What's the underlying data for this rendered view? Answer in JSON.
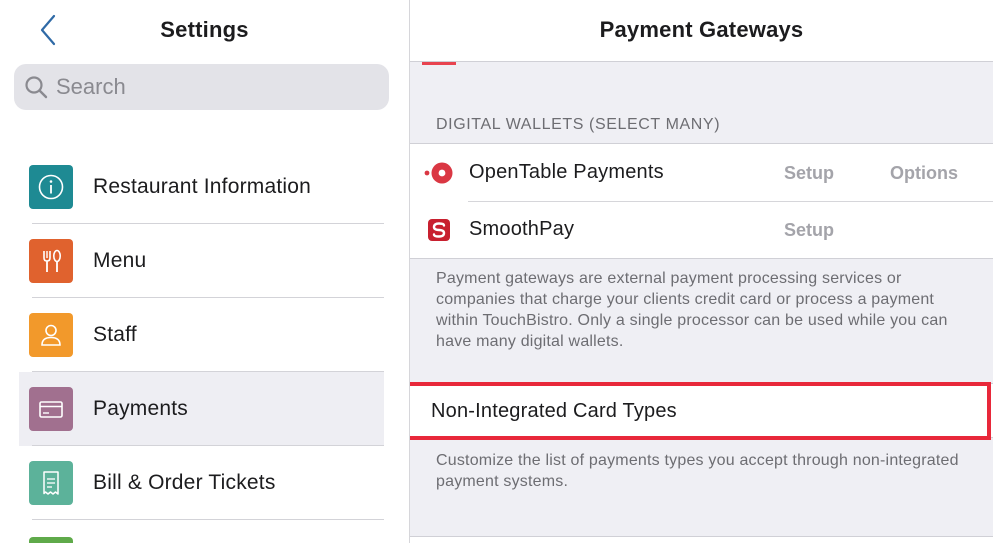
{
  "left": {
    "title": "Settings",
    "search": {
      "placeholder": "Search"
    },
    "items": [
      {
        "label": "Restaurant Information",
        "icon": "info-icon",
        "color": "#1e8a93"
      },
      {
        "label": "Menu",
        "icon": "fork-knife-icon",
        "color": "#e0622e"
      },
      {
        "label": "Staff",
        "icon": "person-icon",
        "color": "#f2992b"
      },
      {
        "label": "Payments",
        "icon": "card-icon",
        "color": "#a1708f",
        "selected": true
      },
      {
        "label": "Bill & Order Tickets",
        "icon": "receipt-icon",
        "color": "#5cb29a"
      }
    ]
  },
  "right": {
    "title": "Payment Gateways",
    "digital_wallets": {
      "header": "DIGITAL WALLETS (SELECT MANY)",
      "rows": [
        {
          "label": "OpenTable Payments",
          "icon": "opentable-logo-icon",
          "setup": "Setup",
          "options": "Options"
        },
        {
          "label": "SmoothPay",
          "icon": "smoothpay-logo-icon",
          "setup": "Setup"
        }
      ],
      "footer": "Payment gateways are external payment processing services or companies that charge your clients credit card or process a payment within TouchBistro. Only a single processor can be used while you can have many digital wallets."
    },
    "non_integrated": {
      "label": "Non-Integrated Card Types",
      "footer": "Customize the list of payments types you accept through non-integrated payment systems."
    }
  },
  "colors": {
    "accent_blue": "#2f6aa6",
    "highlight_red": "#e8283a",
    "opentable_red": "#da3743",
    "smoothpay_red": "#c8202f"
  }
}
